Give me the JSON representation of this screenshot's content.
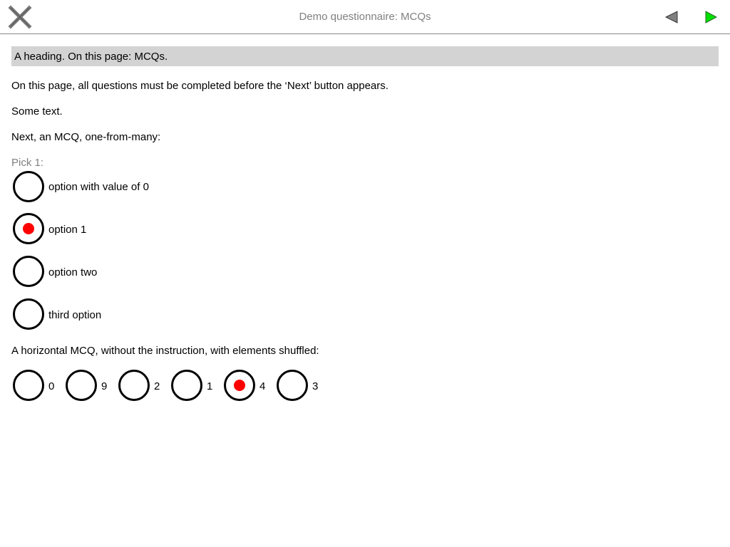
{
  "header": {
    "title": "Demo questionnaire: MCQs",
    "close_icon": "close-x-icon",
    "back_icon": "triangle-left-icon",
    "next_icon": "triangle-right-icon",
    "back_color": "#808080",
    "next_color": "#00e000"
  },
  "page": {
    "heading": "A heading. On this page: MCQs.",
    "text1": "On this page, all questions must be completed before the ‘Next’ button appears.",
    "text2": "Some text.",
    "text3": "Next, an MCQ, one-from-many:",
    "text4": "A horizontal MCQ, without the instruction, with elements shuffled:"
  },
  "mcq1": {
    "instruction": "Pick 1:",
    "selected_index": 1,
    "options": [
      {
        "label": "option with value of 0"
      },
      {
        "label": "option 1"
      },
      {
        "label": "option two"
      },
      {
        "label": "third option"
      }
    ]
  },
  "mcq2": {
    "selected_index": 4,
    "options": [
      {
        "label": "0"
      },
      {
        "label": "9"
      },
      {
        "label": "2"
      },
      {
        "label": "1"
      },
      {
        "label": "4"
      },
      {
        "label": "3"
      }
    ]
  },
  "colors": {
    "selected_dot": "#ff0000",
    "heading_bg": "#d3d3d3",
    "instruction_text": "#808080"
  }
}
